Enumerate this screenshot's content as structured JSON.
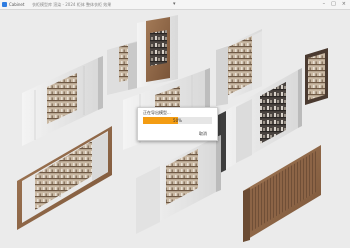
{
  "titlebar": {
    "app_name": "Cabinet",
    "doc_title": "衣柜模型库 渲染 - 2024 柜体 整体衣柜 效果",
    "center_mark": "▾",
    "minimize": "–",
    "maximize": "□",
    "close": "×"
  },
  "dialog": {
    "title": "正在导出模型...",
    "progress_text": "50%",
    "progress": 0.5,
    "cancel_label": "取消"
  },
  "colors": {
    "accent": "#f39c12",
    "background": "#ebebeb"
  }
}
